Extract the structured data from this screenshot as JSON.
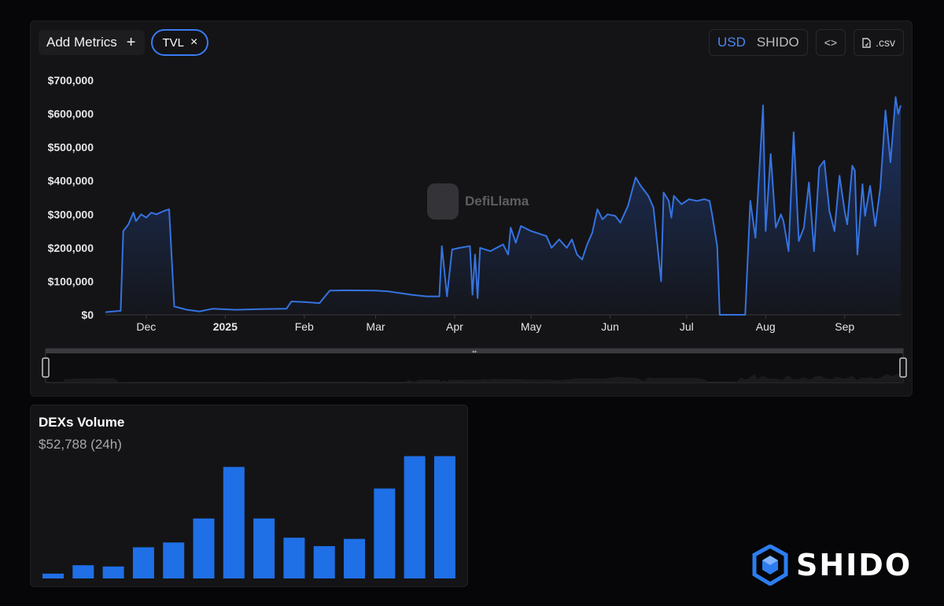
{
  "toolbar": {
    "add_metrics_label": "Add Metrics",
    "add_icon": "+",
    "metric_pill_label": "TVL",
    "remove_icon": "×",
    "currency_usd": "USD",
    "currency_token": "SHIDO",
    "embed_icon": "<>",
    "csv_label": ".csv"
  },
  "watermark": {
    "text": "DefiLlama"
  },
  "colors": {
    "accent": "#3a7bf2",
    "line": "#3573e0",
    "bar": "#1f6fe6",
    "background": "#141416"
  },
  "chart_data": [
    {
      "type": "area",
      "series": [
        {
          "name": "TVL",
          "points": [
            [
              "2024-11-15",
              8000
            ],
            [
              "2024-11-21",
              12000
            ],
            [
              "2024-11-22",
              250000
            ],
            [
              "2024-11-24",
              270000
            ],
            [
              "2024-11-26",
              305000
            ],
            [
              "2024-11-27",
              280000
            ],
            [
              "2024-11-29",
              300000
            ],
            [
              "2024-12-01",
              290000
            ],
            [
              "2024-12-03",
              305000
            ],
            [
              "2024-12-05",
              300000
            ],
            [
              "2024-12-08",
              310000
            ],
            [
              "2024-12-10",
              315000
            ],
            [
              "2024-12-12",
              25000
            ],
            [
              "2024-12-17",
              15000
            ],
            [
              "2024-12-22",
              10000
            ],
            [
              "2024-12-27",
              18000
            ],
            [
              "2025-01-05",
              15000
            ],
            [
              "2025-01-15",
              17000
            ],
            [
              "2025-01-25",
              18000
            ],
            [
              "2025-01-27",
              40000
            ],
            [
              "2025-02-01",
              38000
            ],
            [
              "2025-02-07",
              35000
            ],
            [
              "2025-02-11",
              72000
            ],
            [
              "2025-02-18",
              73000
            ],
            [
              "2025-03-01",
              72000
            ],
            [
              "2025-03-06",
              70000
            ],
            [
              "2025-03-15",
              60000
            ],
            [
              "2025-03-21",
              55000
            ],
            [
              "2025-03-26",
              55000
            ],
            [
              "2025-03-27",
              205000
            ],
            [
              "2025-03-29",
              55000
            ],
            [
              "2025-03-31",
              195000
            ],
            [
              "2025-04-03",
              200000
            ],
            [
              "2025-04-07",
              205000
            ],
            [
              "2025-04-08",
              60000
            ],
            [
              "2025-04-09",
              180000
            ],
            [
              "2025-04-10",
              50000
            ],
            [
              "2025-04-11",
              200000
            ],
            [
              "2025-04-15",
              190000
            ],
            [
              "2025-04-20",
              210000
            ],
            [
              "2025-04-22",
              180000
            ],
            [
              "2025-04-23",
              260000
            ],
            [
              "2025-04-25",
              215000
            ],
            [
              "2025-04-27",
              265000
            ],
            [
              "2025-05-01",
              250000
            ],
            [
              "2025-05-05",
              240000
            ],
            [
              "2025-05-07",
              235000
            ],
            [
              "2025-05-09",
              200000
            ],
            [
              "2025-05-12",
              225000
            ],
            [
              "2025-05-15",
              200000
            ],
            [
              "2025-05-17",
              225000
            ],
            [
              "2025-05-19",
              180000
            ],
            [
              "2025-05-21",
              165000
            ],
            [
              "2025-05-23",
              210000
            ],
            [
              "2025-05-25",
              245000
            ],
            [
              "2025-05-27",
              315000
            ],
            [
              "2025-05-29",
              285000
            ],
            [
              "2025-05-31",
              300000
            ],
            [
              "2025-06-03",
              295000
            ],
            [
              "2025-06-05",
              275000
            ],
            [
              "2025-06-08",
              325000
            ],
            [
              "2025-06-11",
              410000
            ],
            [
              "2025-06-13",
              385000
            ],
            [
              "2025-06-16",
              355000
            ],
            [
              "2025-06-18",
              320000
            ],
            [
              "2025-06-21",
              100000
            ],
            [
              "2025-06-22",
              365000
            ],
            [
              "2025-06-24",
              340000
            ],
            [
              "2025-06-25",
              290000
            ],
            [
              "2025-06-26",
              355000
            ],
            [
              "2025-06-29",
              330000
            ],
            [
              "2025-07-02",
              345000
            ],
            [
              "2025-07-05",
              340000
            ],
            [
              "2025-07-08",
              345000
            ],
            [
              "2025-07-10",
              340000
            ],
            [
              "2025-07-11",
              300000
            ],
            [
              "2025-07-13",
              205000
            ],
            [
              "2025-07-14",
              0
            ],
            [
              "2025-07-20",
              0
            ],
            [
              "2025-07-24",
              0
            ],
            [
              "2025-07-26",
              340000
            ],
            [
              "2025-07-28",
              230000
            ],
            [
              "2025-07-31",
              625000
            ],
            [
              "2025-08-01",
              250000
            ],
            [
              "2025-08-03",
              480000
            ],
            [
              "2025-08-05",
              260000
            ],
            [
              "2025-08-07",
              300000
            ],
            [
              "2025-08-08",
              280000
            ],
            [
              "2025-08-10",
              190000
            ],
            [
              "2025-08-12",
              545000
            ],
            [
              "2025-08-14",
              220000
            ],
            [
              "2025-08-16",
              260000
            ],
            [
              "2025-08-18",
              395000
            ],
            [
              "2025-08-20",
              190000
            ],
            [
              "2025-08-22",
              440000
            ],
            [
              "2025-08-24",
              460000
            ],
            [
              "2025-08-26",
              310000
            ],
            [
              "2025-08-28",
              250000
            ],
            [
              "2025-08-30",
              415000
            ],
            [
              "2025-09-01",
              310000
            ],
            [
              "2025-09-02",
              270000
            ],
            [
              "2025-09-04",
              445000
            ],
            [
              "2025-09-05",
              430000
            ],
            [
              "2025-09-06",
              180000
            ],
            [
              "2025-09-08",
              390000
            ],
            [
              "2025-09-09",
              295000
            ],
            [
              "2025-09-11",
              385000
            ],
            [
              "2025-09-13",
              265000
            ],
            [
              "2025-09-15",
              380000
            ],
            [
              "2025-09-17",
              610000
            ],
            [
              "2025-09-19",
              455000
            ],
            [
              "2025-09-21",
              650000
            ],
            [
              "2025-09-22",
              600000
            ],
            [
              "2025-09-23",
              625000
            ]
          ]
        }
      ],
      "y_ticks": [
        "$0",
        "$100,000",
        "$200,000",
        "$300,000",
        "$400,000",
        "$500,000",
        "$600,000",
        "$700,000"
      ],
      "ylim": [
        0,
        700000
      ],
      "x_ticks": [
        {
          "label": "Dec",
          "date": "2024-12-01",
          "bold": false
        },
        {
          "label": "2025",
          "date": "2025-01-01",
          "bold": true
        },
        {
          "label": "Feb",
          "date": "2025-02-01",
          "bold": false
        },
        {
          "label": "Mar",
          "date": "2025-03-01",
          "bold": false
        },
        {
          "label": "Apr",
          "date": "2025-04-01",
          "bold": false
        },
        {
          "label": "May",
          "date": "2025-05-01",
          "bold": false
        },
        {
          "label": "Jun",
          "date": "2025-06-01",
          "bold": false
        },
        {
          "label": "Jul",
          "date": "2025-07-01",
          "bold": false
        },
        {
          "label": "Aug",
          "date": "2025-08-01",
          "bold": false
        },
        {
          "label": "Sep",
          "date": "2025-09-01",
          "bold": false
        }
      ],
      "xlim": [
        "2024-11-15",
        "2025-09-23"
      ],
      "grid": false
    },
    {
      "type": "bar",
      "title": "DEXs Volume",
      "subtitle": "$52,788 (24h)",
      "values": [
        4,
        11,
        10,
        26,
        30,
        50,
        93,
        50,
        34,
        27,
        33,
        75,
        102,
        102
      ],
      "ylim": [
        0,
        105
      ]
    }
  ],
  "brand": {
    "name": "SHIDO"
  }
}
